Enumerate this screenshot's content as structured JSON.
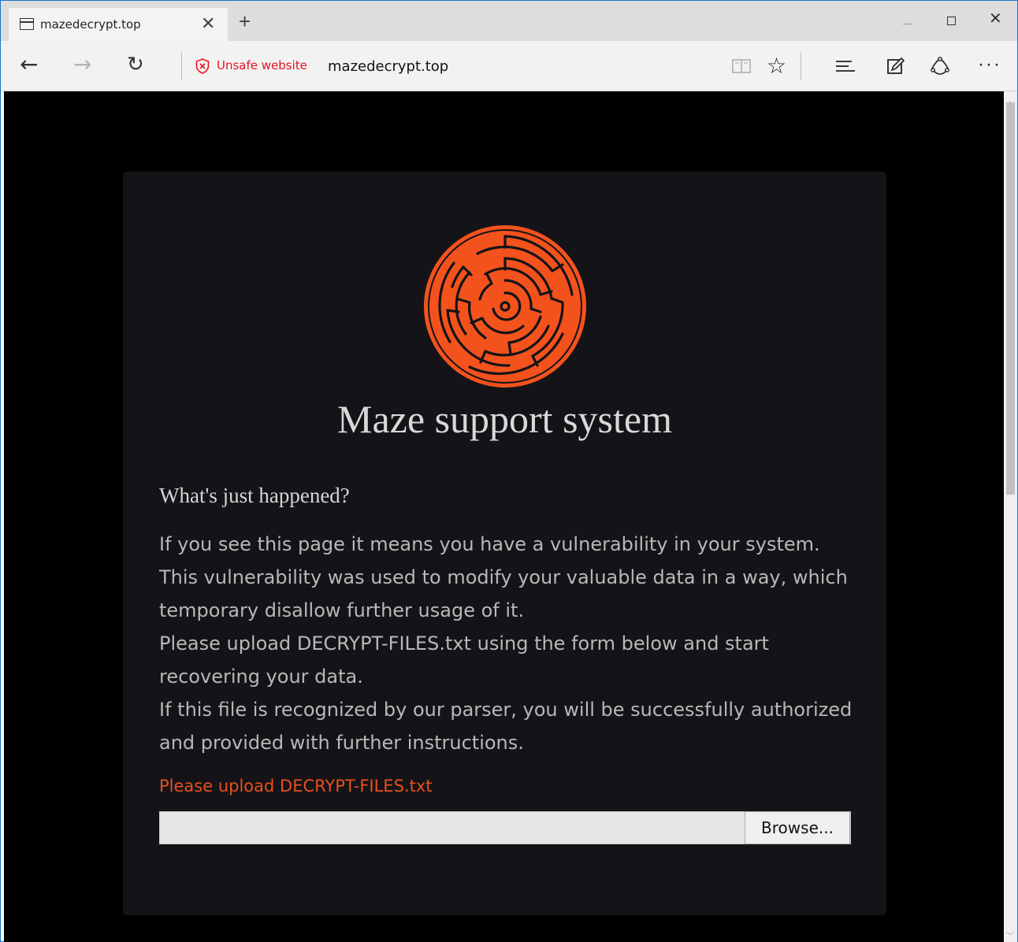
{
  "browser": {
    "tab_title": "mazedecrypt.top",
    "tab_close_glyph": "✕",
    "new_tab_glyph": "+",
    "security_label": "Unsafe website",
    "url": "mazedecrypt.top",
    "star_glyph": "☆",
    "more_glyph": "···",
    "back_glyph": "←",
    "forward_glyph": "→",
    "refresh_glyph": "↻",
    "close_glyph": "✕",
    "icons": [
      "page-icon",
      "close-icon",
      "plus-icon",
      "back-arrow-icon",
      "forward-arrow-icon",
      "refresh-icon",
      "shield-warning-icon",
      "reading-view-icon",
      "star-icon",
      "hub-icon",
      "web-note-icon",
      "share-icon",
      "more-icon"
    ],
    "colors": {
      "unsafe": "#e81123"
    }
  },
  "page": {
    "title": "Maze support system",
    "heading": "What's just happened?",
    "paragraphs": [
      "If you see this page it means you have a vulnerability in your system.",
      "This vulnerability was used to modify your valuable data in a way, which temporary disallow further usage of it.",
      "Please upload DECRYPT-FILES.txt using the form below and start recovering your data.",
      "If this file is recognized by our parser, you will be successfully authorized and provided with further instructions."
    ],
    "upload_label": "Please upload DECRYPT-FILES.txt",
    "file_input_value": "",
    "browse_label": "Browse...",
    "colors": {
      "accent": "#e8501c",
      "logo": "#f4521c",
      "card_bg": "#141418",
      "page_bg": "#000000"
    }
  }
}
